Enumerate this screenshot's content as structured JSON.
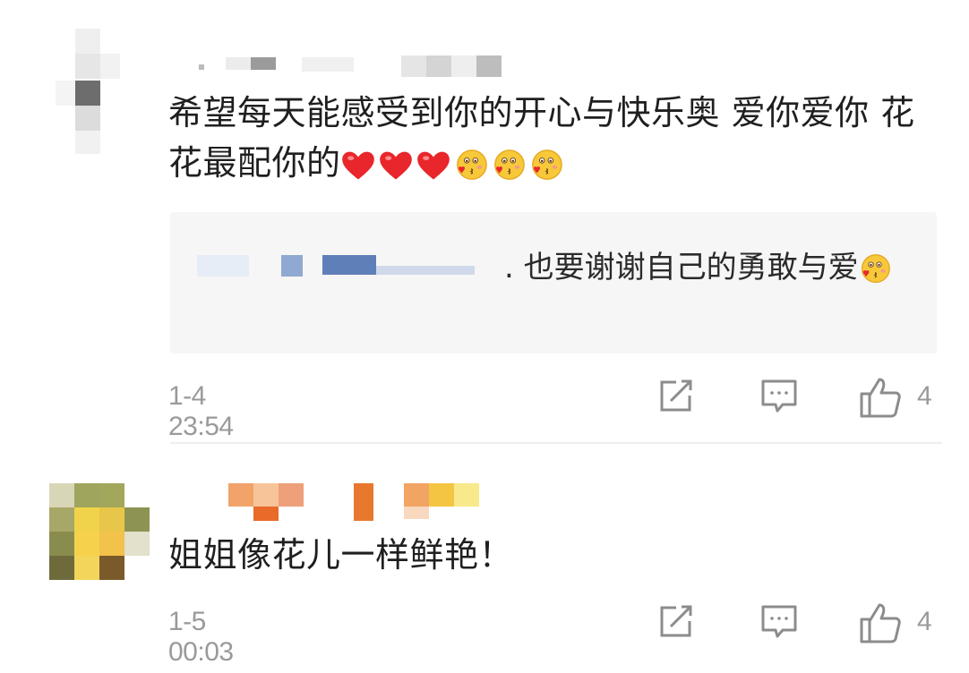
{
  "comments": [
    {
      "text": "希望每天能感受到你的开心与快乐奥 爱你爱你 花花最配你的",
      "emoji_sequence": [
        "heart-emoji",
        "heart-emoji",
        "heart-emoji",
        "blushing-kiss-emoji",
        "blushing-kiss-emoji",
        "blushing-kiss-emoji"
      ],
      "reply": {
        "text": ". 也要谢谢自己的勇敢与爱",
        "emoji_sequence": [
          "blushing-kiss-emoji"
        ]
      },
      "time": "1-4 23:54",
      "like_count": "4"
    },
    {
      "text": "姐姐像花儿一样鲜艳！",
      "time": "1-5 00:03",
      "like_count": "4"
    }
  ],
  "colors": {
    "heart": "#e8262c",
    "emoji_face": "#f7c83a",
    "meta_gray": "#9a9a9a",
    "reply_bg": "#f6f6f6"
  }
}
